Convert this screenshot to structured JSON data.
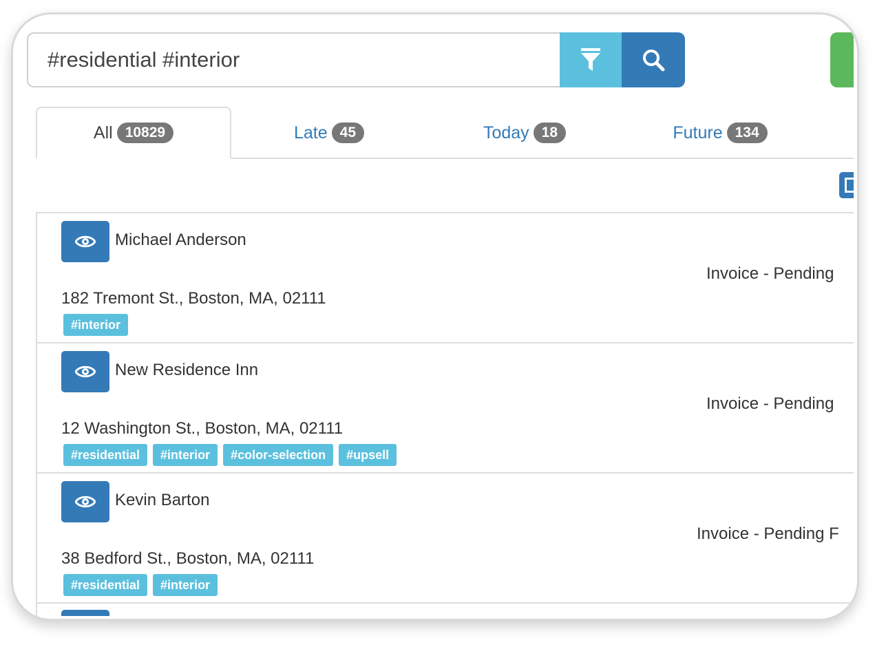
{
  "search": {
    "value": "#residential #interior"
  },
  "tabs": [
    {
      "label": "All",
      "count": "10829"
    },
    {
      "label": "Late",
      "count": "45"
    },
    {
      "label": "Today",
      "count": "18"
    },
    {
      "label": "Future",
      "count": "134"
    }
  ],
  "rows": [
    {
      "name": "Michael Anderson",
      "status": "Invoice - Pending",
      "address": "182 Tremont St., Boston, MA, 02111",
      "tags": [
        "#interior"
      ]
    },
    {
      "name": "New Residence Inn",
      "status": "Invoice - Pending",
      "address": "12 Washington St., Boston, MA, 02111",
      "tags": [
        "#residential",
        "#interior",
        "#color-selection",
        "#upsell"
      ]
    },
    {
      "name": "Kevin Barton",
      "status": "Invoice - Pending F",
      "address": "38 Bedford St., Boston, MA, 02111",
      "tags": [
        "#residential",
        "#interior"
      ]
    }
  ],
  "colors": {
    "primary": "#337ab7",
    "info": "#5bc0de",
    "success": "#5cb85c",
    "badge": "#777777"
  }
}
